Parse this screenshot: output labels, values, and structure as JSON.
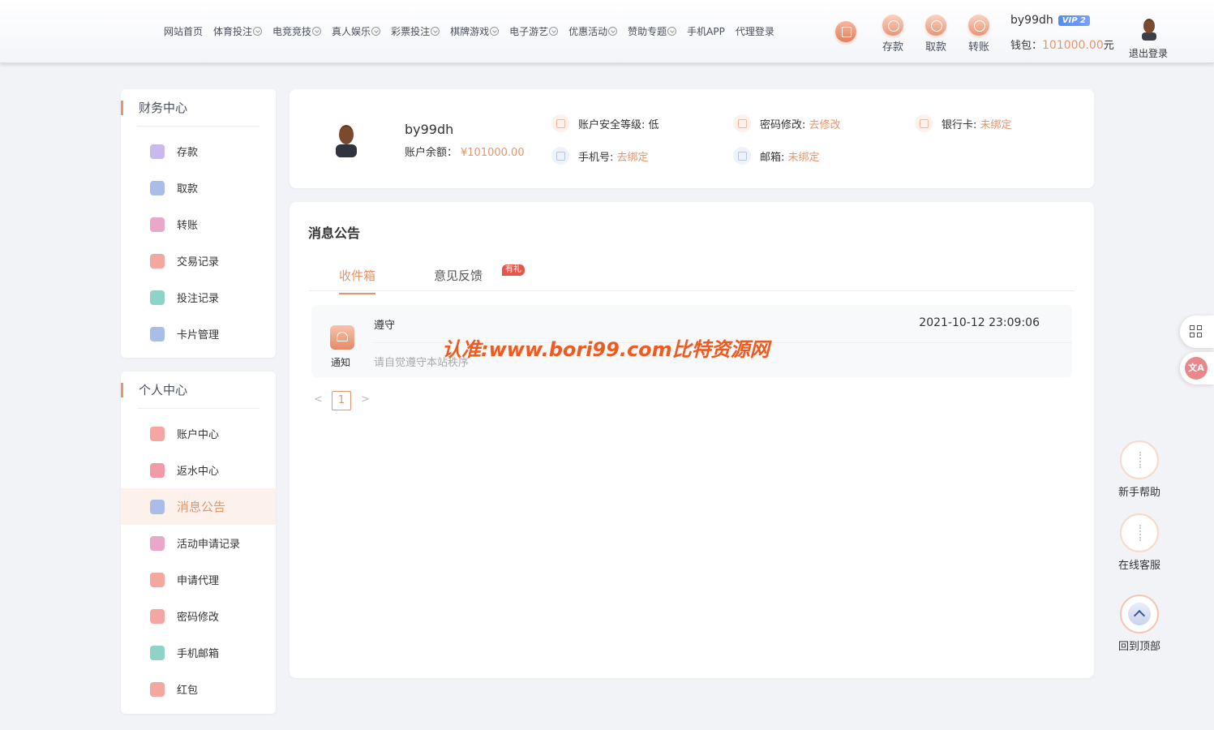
{
  "nav": {
    "items": [
      {
        "label": "网站首页",
        "dropdown": false
      },
      {
        "label": "体育投注",
        "dropdown": true
      },
      {
        "label": "电竞竞技",
        "dropdown": true
      },
      {
        "label": "真人娱乐",
        "dropdown": true
      },
      {
        "label": "彩票投注",
        "dropdown": true
      },
      {
        "label": "棋牌游戏",
        "dropdown": true
      },
      {
        "label": "电子游艺",
        "dropdown": true
      },
      {
        "label": "优惠活动",
        "dropdown": true
      },
      {
        "label": "赞助专题",
        "dropdown": true
      },
      {
        "label": "手机APP",
        "dropdown": false
      },
      {
        "label": "代理登录",
        "dropdown": false
      }
    ]
  },
  "header": {
    "deposit": "存款",
    "withdraw": "取款",
    "transfer": "转账",
    "username": "by99dh",
    "vip": "VIP 2",
    "wallet_label": "钱包：",
    "wallet_amount": "101000.00",
    "wallet_unit": "元",
    "logout": "退出登录"
  },
  "finance": {
    "title": "财务中心",
    "items": [
      "存款",
      "取款",
      "转账",
      "交易记录",
      "投注记录",
      "卡片管理"
    ]
  },
  "personal": {
    "title": "个人中心",
    "items": [
      "账户中心",
      "返水中心",
      "消息公告",
      "活动申请记录",
      "申请代理",
      "密码修改",
      "手机邮箱",
      "红包"
    ],
    "active_index": 2
  },
  "profile": {
    "username": "by99dh",
    "balance_label": "账户余额：",
    "balance": "¥101000.00",
    "security_label": "账户安全等级:",
    "security_value": "低",
    "password_label": "密码修改:",
    "password_value": "去修改",
    "bank_label": "银行卡:",
    "bank_value": "未绑定",
    "phone_label": "手机号:",
    "phone_value": "去绑定",
    "email_label": "邮箱:",
    "email_value": "未绑定"
  },
  "messages": {
    "title": "消息公告",
    "tab_inbox": "收件箱",
    "tab_feedback": "意见反馈",
    "feedback_badge": "有礼",
    "notice": {
      "type": "通知",
      "subject": "遵守",
      "time": "2021-10-12 23:09:06",
      "body": "请自觉遵守本站秩序"
    },
    "pagination": {
      "prev": "<",
      "page": "1",
      "next": ">"
    }
  },
  "float": {
    "help": "新手帮助",
    "service": "在线客服",
    "top": "回到顶部"
  },
  "watermark": "认准:www.bori99.com比特资源网",
  "colors": {
    "accent": "#e4956c",
    "badge": "#e4564e",
    "vip": "#4f8cf7",
    "watermark": "#f05a1e"
  }
}
